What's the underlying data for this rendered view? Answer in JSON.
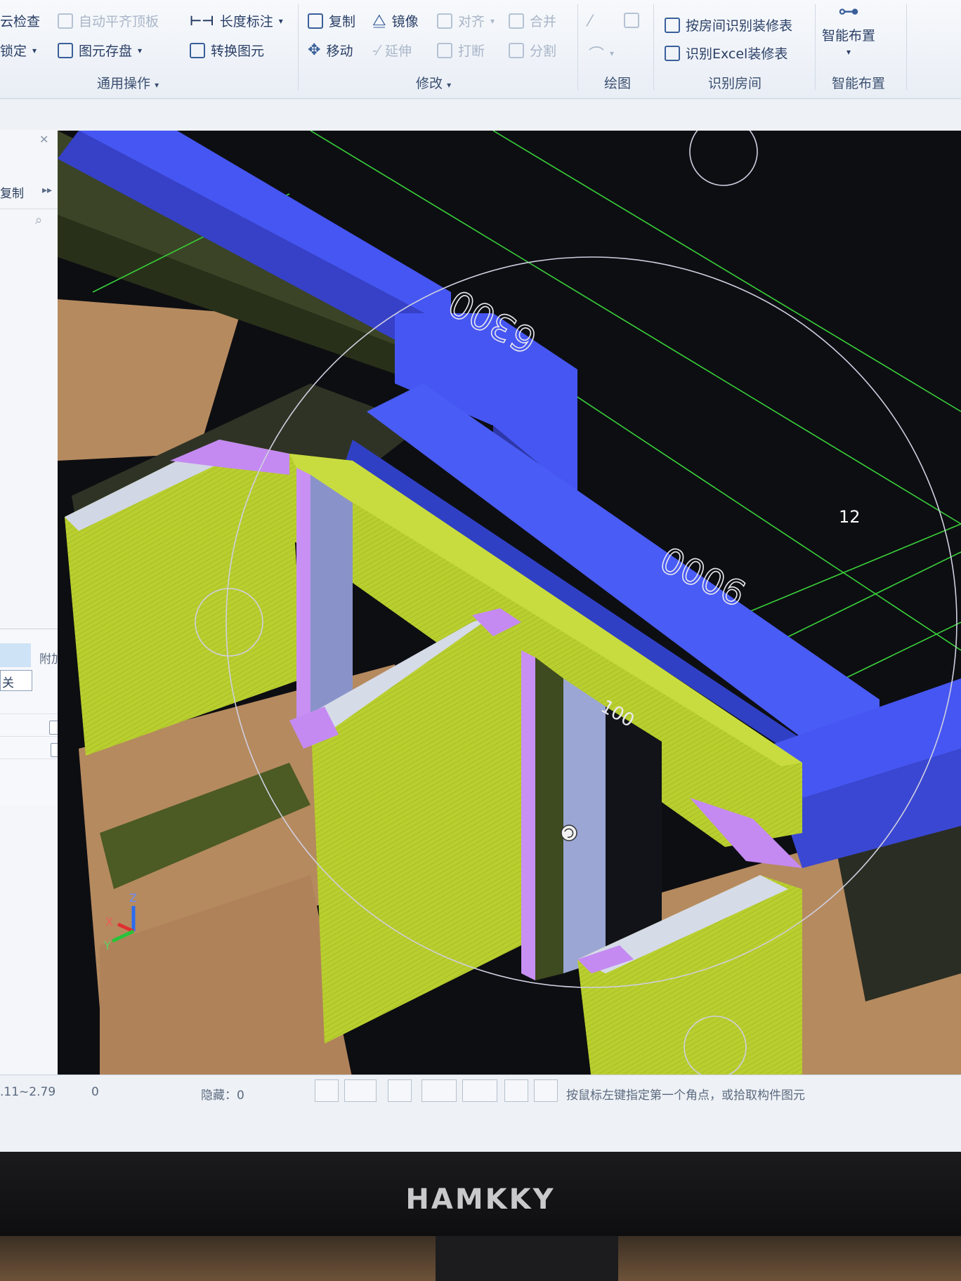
{
  "ribbon": {
    "common": {
      "cloud_check": "云检查",
      "auto_align_slab": "自动平齐顶板",
      "length_dim": "长度标注",
      "lock": "锁定",
      "save_element": "图元存盘",
      "convert_element": "转换图元",
      "group_label": "通用操作"
    },
    "modify": {
      "copy": "复制",
      "mirror": "镜像",
      "align": "对齐",
      "merge": "合并",
      "move": "移动",
      "extend": "延伸",
      "break": "打断",
      "split": "分割",
      "group_label": "修改"
    },
    "draw": {
      "group_label": "绘图"
    },
    "identify_room": {
      "by_room_table": "按房间识别装修表",
      "by_excel": "识别Excel装修表",
      "group_label": "识别房间"
    },
    "smart_layout": {
      "button": "智能布置",
      "group_label": "智能布置"
    }
  },
  "left_panel": {
    "copy_label": "复制",
    "attach_header": "附加",
    "row_label": "关"
  },
  "viewport": {
    "dim_6300": "6300",
    "dim_9000": "9000",
    "dim_100": "100",
    "axis_12": "12",
    "axis_x": "X",
    "axis_y": "Y",
    "axis_z": "Z"
  },
  "statusbar": {
    "range": ".11~2.79",
    "count": "0",
    "hidden": "隐藏：0",
    "prompt": "按鼠标左键指定第一个角点，或拾取构件图元"
  },
  "monitor": {
    "brand": "HAMKKY"
  },
  "colors": {
    "beam": "#4657f0",
    "wall": "#b7cd2e",
    "wall_dark": "#7f8f22",
    "floor": "#b88a5c",
    "opening": "#c98df0",
    "grid": "#39d13a"
  }
}
